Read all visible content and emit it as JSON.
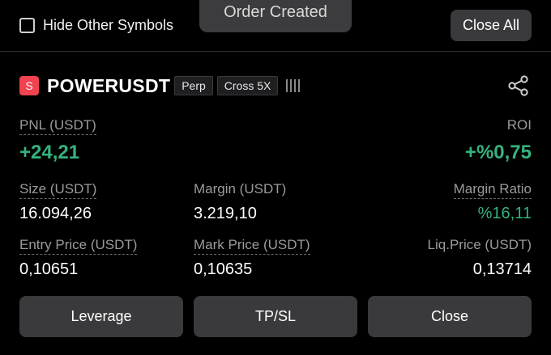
{
  "top": {
    "hide_label": "Hide Other Symbols",
    "close_all_label": "Close All",
    "toast": "Order Created"
  },
  "position": {
    "symbol_badge": "S",
    "symbol": "POWERUSDT",
    "tags": [
      "Perp",
      "Cross 5X"
    ],
    "bars": "!!!!",
    "pnl_label": "PNL (USDT)",
    "pnl_value": "+24,21",
    "roi_label": "ROI",
    "roi_value": "+%0,75",
    "size_label": "Size (USDT)",
    "size_value": "16.094,26",
    "margin_label": "Margin (USDT)",
    "margin_value": "3.219,10",
    "margin_ratio_label": "Margin Ratio",
    "margin_ratio_value": "%16,11",
    "entry_label": "Entry Price (USDT)",
    "entry_value": "0,10651",
    "mark_label": "Mark Price (USDT)",
    "mark_value": "0,10635",
    "liq_label": "Liq.Price (USDT)",
    "liq_value": "0,13714"
  },
  "actions": {
    "leverage": "Leverage",
    "tpsl": "TP/SL",
    "close": "Close"
  },
  "colors": {
    "positive": "#35b37e",
    "symbol_badge": "#f0424f",
    "button_bg": "#3a3a3c"
  },
  "icons": [
    "checkbox-icon",
    "share-icon",
    "signal-bars-icon"
  ]
}
